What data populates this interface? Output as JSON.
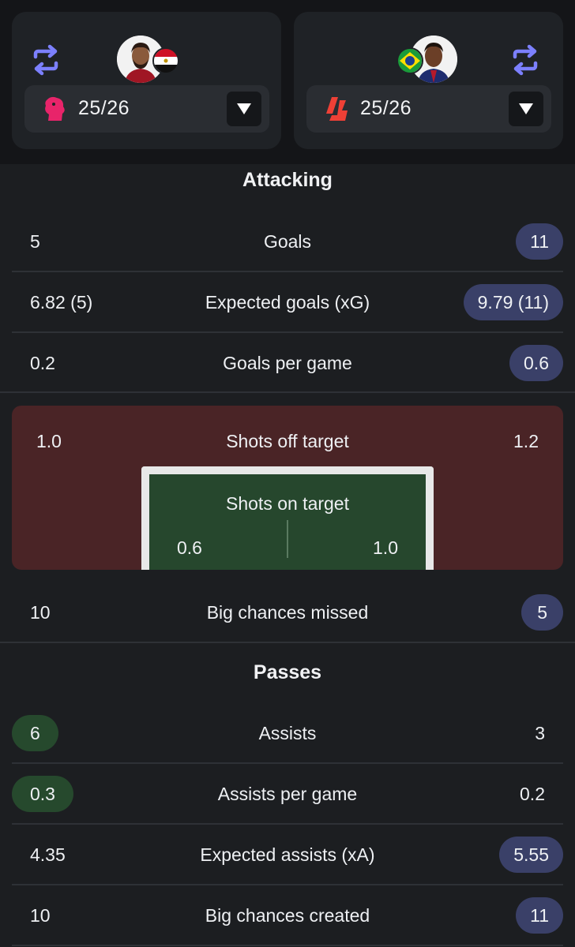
{
  "players": {
    "left": {
      "season": "25/26",
      "league_logo": "premier-league-logo",
      "flag": "egypt-flag"
    },
    "right": {
      "season": "25/26",
      "league_logo": "laliga-logo",
      "flag": "brazil-flag"
    }
  },
  "colors": {
    "background": "#1c1e21",
    "card": "#1f2226",
    "right_highlight": "#3a4068",
    "left_highlight": "#26492d",
    "shots_off": "#4a2426",
    "shots_on": "#26472d",
    "swap_icon": "#7c80ff"
  },
  "attacking": {
    "title": "Attacking",
    "goals": {
      "left": "5",
      "label": "Goals",
      "right": "11"
    },
    "xg": {
      "left": "6.82 (5)",
      "label": "Expected goals (xG)",
      "right": "9.79 (11)"
    },
    "goals_per_game": {
      "left": "0.2",
      "label": "Goals per game",
      "right": "0.6"
    },
    "shots_off": {
      "left": "1.0",
      "label": "Shots off target",
      "right": "1.2"
    },
    "shots_on": {
      "left": "0.6",
      "label": "Shots on target",
      "right": "1.0"
    },
    "big_chances_missed": {
      "left": "10",
      "label": "Big chances missed",
      "right": "5"
    }
  },
  "passes": {
    "title": "Passes",
    "assists": {
      "left": "6",
      "label": "Assists",
      "right": "3"
    },
    "assists_per_game": {
      "left": "0.3",
      "label": "Assists per game",
      "right": "0.2"
    },
    "xa": {
      "left": "4.35",
      "label": "Expected assists (xA)",
      "right": "5.55"
    },
    "big_chances_created": {
      "left": "10",
      "label": "Big chances created",
      "right": "11"
    }
  }
}
